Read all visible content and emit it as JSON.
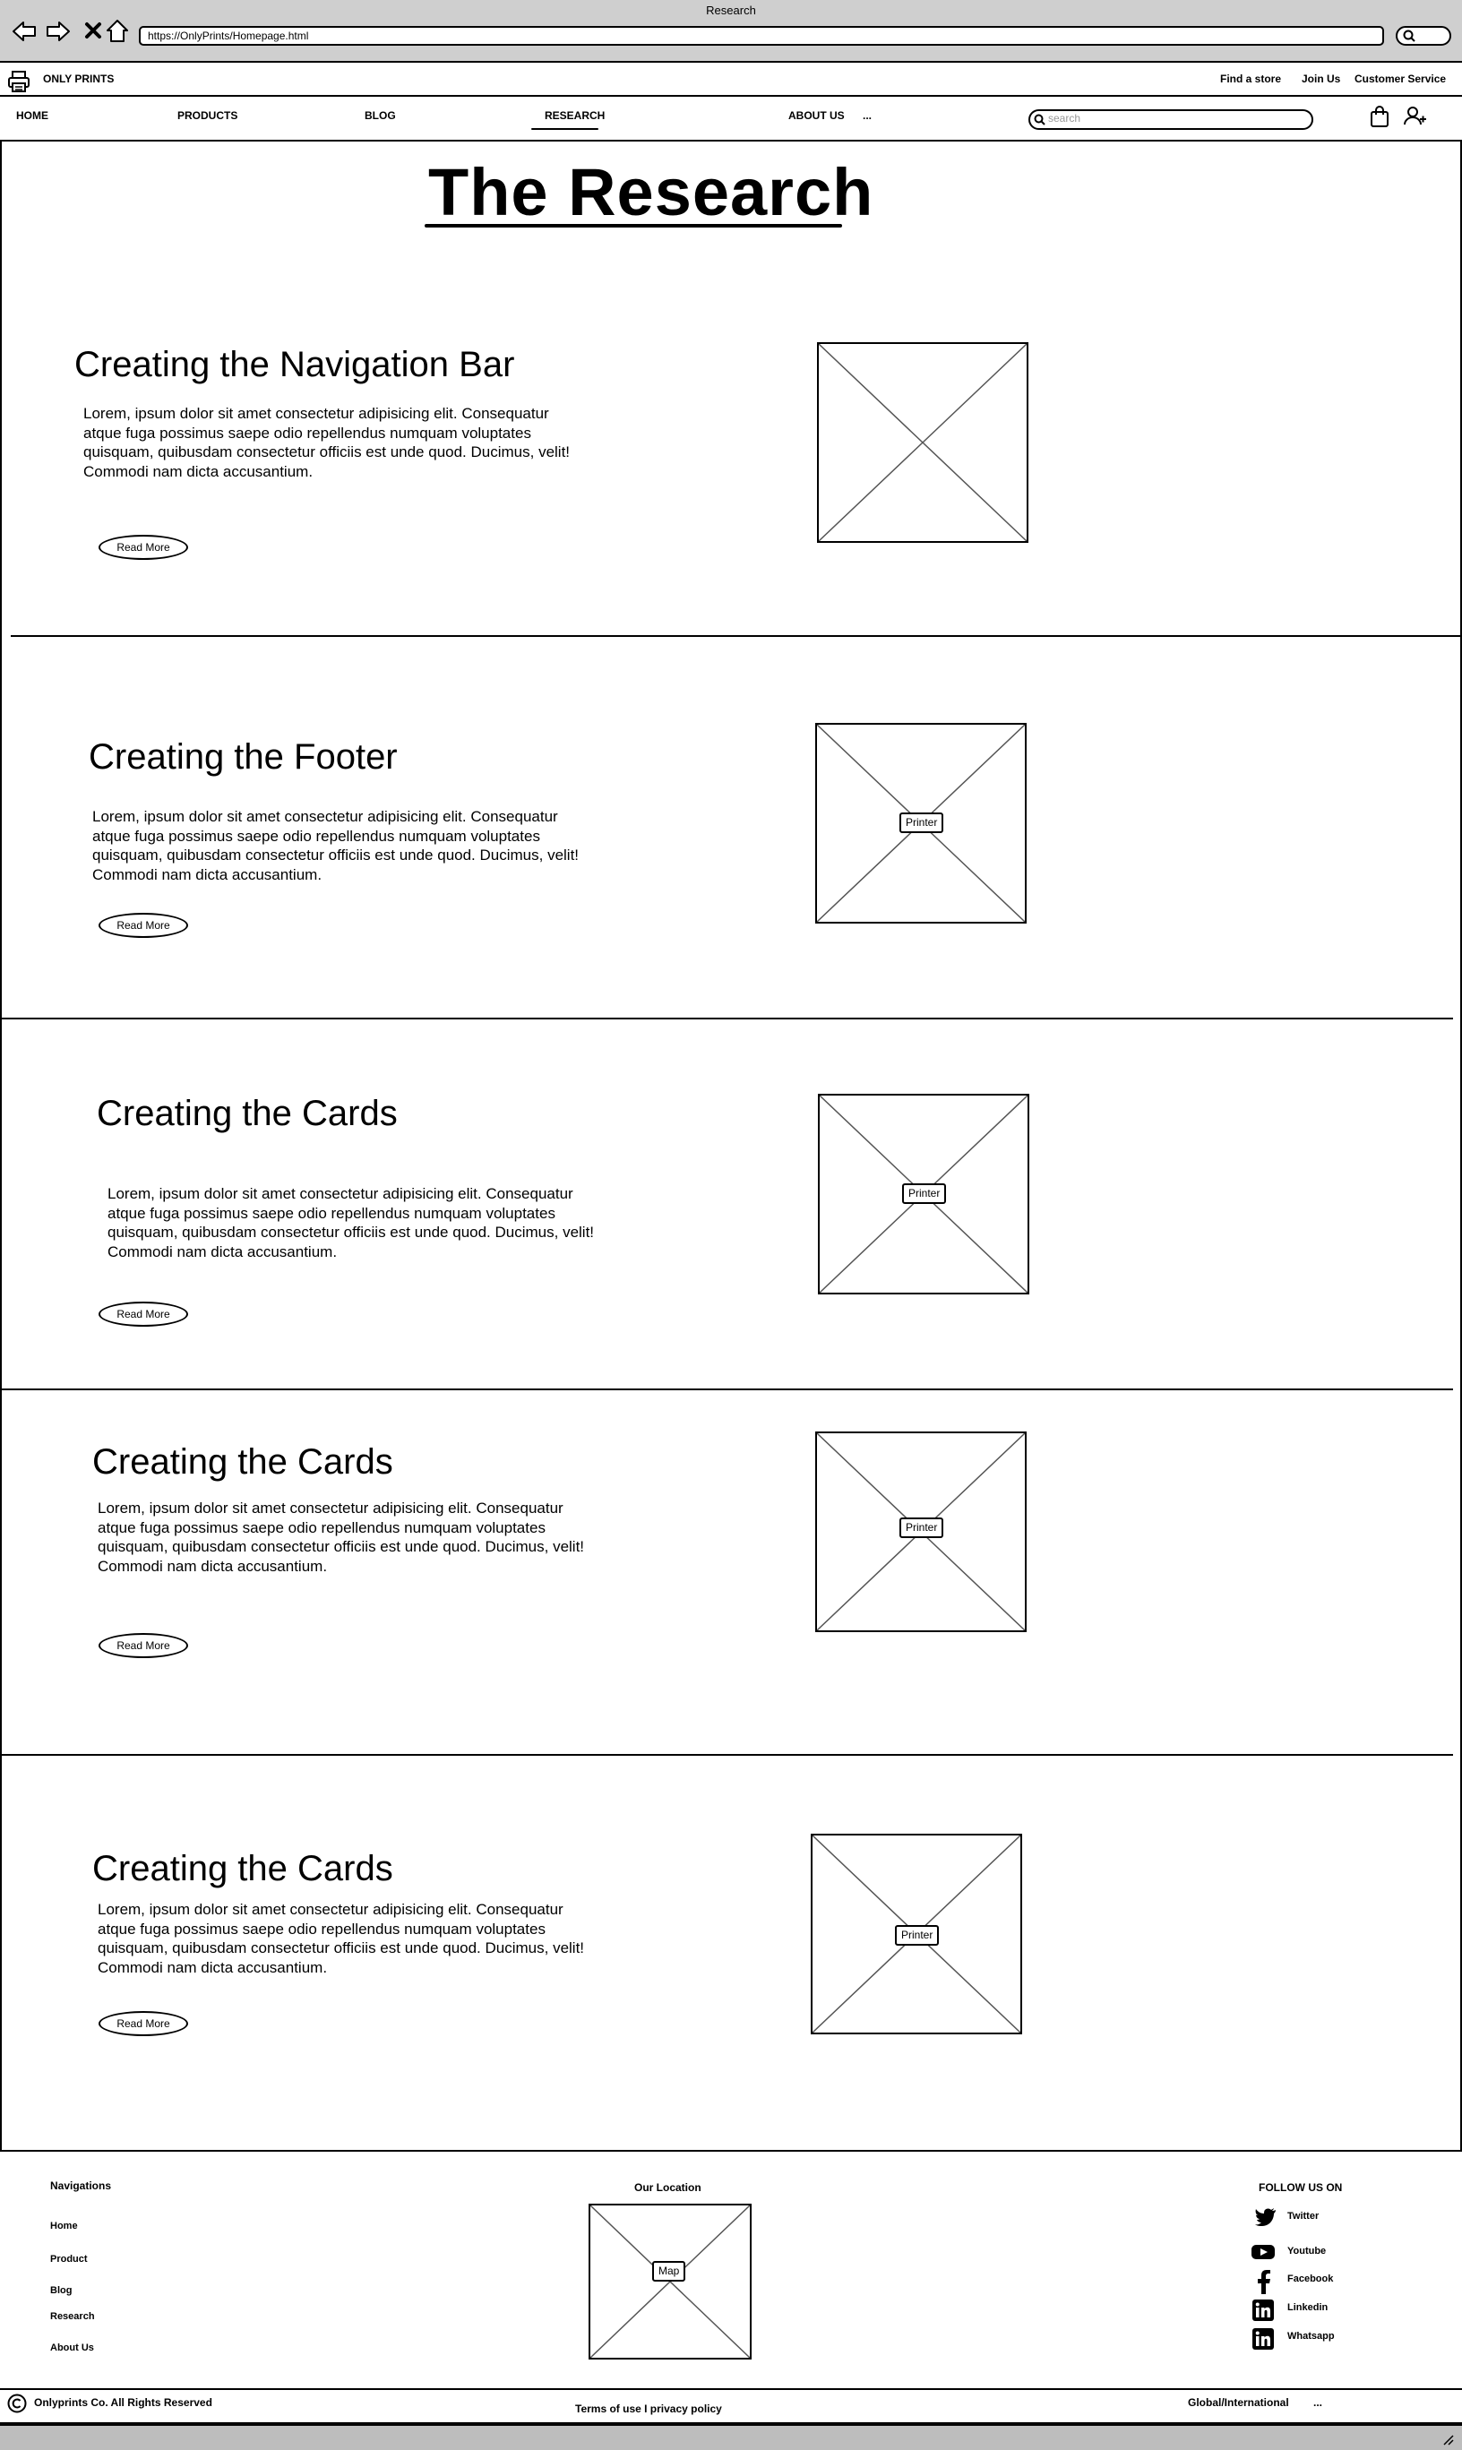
{
  "browser": {
    "window_title": "Research",
    "url": "https://OnlyPrints/Homepage.html"
  },
  "topbar": {
    "brand": "ONLY PRINTS",
    "links": [
      "Find a store",
      "Join Us",
      "Customer Service"
    ]
  },
  "nav": {
    "items": [
      "HOME",
      "PRODUCTS",
      "BLOG",
      "RESEARCH",
      "ABOUT US"
    ],
    "more": "...",
    "active": "RESEARCH",
    "search_placeholder": "search"
  },
  "page": {
    "title": "The Research",
    "read_more_label": "Read More",
    "sections": [
      {
        "title": "Creating the Navigation Bar",
        "body": "Lorem, ipsum dolor sit amet consectetur adipisicing elit. Consequatur atque fuga possimus saepe odio repellendus numquam voluptates quisquam, quibusdam consectetur officiis est unde quod. Ducimus, velit! Commodi nam dicta accusantium.",
        "image_label": ""
      },
      {
        "title": "Creating the Footer",
        "body": "Lorem, ipsum dolor sit amet consectetur adipisicing elit. Consequatur atque fuga possimus saepe odio repellendus numquam voluptates quisquam, quibusdam consectetur officiis est unde quod. Ducimus, velit! Commodi nam dicta accusantium.",
        "image_label": "Printer"
      },
      {
        "title": "Creating the Cards",
        "body": "Lorem, ipsum dolor sit amet consectetur adipisicing elit. Consequatur atque fuga possimus saepe odio repellendus numquam voluptates quisquam, quibusdam consectetur officiis est unde quod. Ducimus, velit! Commodi nam dicta accusantium.",
        "image_label": "Printer"
      },
      {
        "title": "Creating the Cards",
        "body": "Lorem, ipsum dolor sit amet consectetur adipisicing elit. Consequatur atque fuga possimus saepe odio repellendus numquam voluptates quisquam, quibusdam consectetur officiis est unde quod. Ducimus, velit! Commodi nam dicta accusantium.",
        "image_label": "Printer"
      },
      {
        "title": "Creating the Cards",
        "body": "Lorem, ipsum dolor sit amet consectetur adipisicing elit. Consequatur atque fuga possimus saepe odio repellendus numquam voluptates quisquam, quibusdam consectetur officiis est unde quod. Ducimus, velit! Commodi nam dicta accusantium.",
        "image_label": "Printer"
      }
    ]
  },
  "footer": {
    "nav_heading": "Navigations",
    "nav_links": [
      "Home",
      "Product",
      "Blog",
      "Research",
      "About Us"
    ],
    "location_heading": "Our Location",
    "map_label": "Map",
    "follow_heading": "FOLLOW US ON",
    "socials": [
      {
        "label": "Twitter",
        "icon": "twitter-icon"
      },
      {
        "label": "Youtube",
        "icon": "youtube-icon"
      },
      {
        "label": "Facebook",
        "icon": "facebook-icon"
      },
      {
        "label": "Linkedin",
        "icon": "linkedin-icon"
      },
      {
        "label": "Whatsapp",
        "icon": "linkedin-icon"
      }
    ]
  },
  "bottom": {
    "copyright": "Onlyprints Co. All Rights Reserved",
    "legal": "Terms of use I privacy policy",
    "region": "Global/International",
    "more": "..."
  }
}
